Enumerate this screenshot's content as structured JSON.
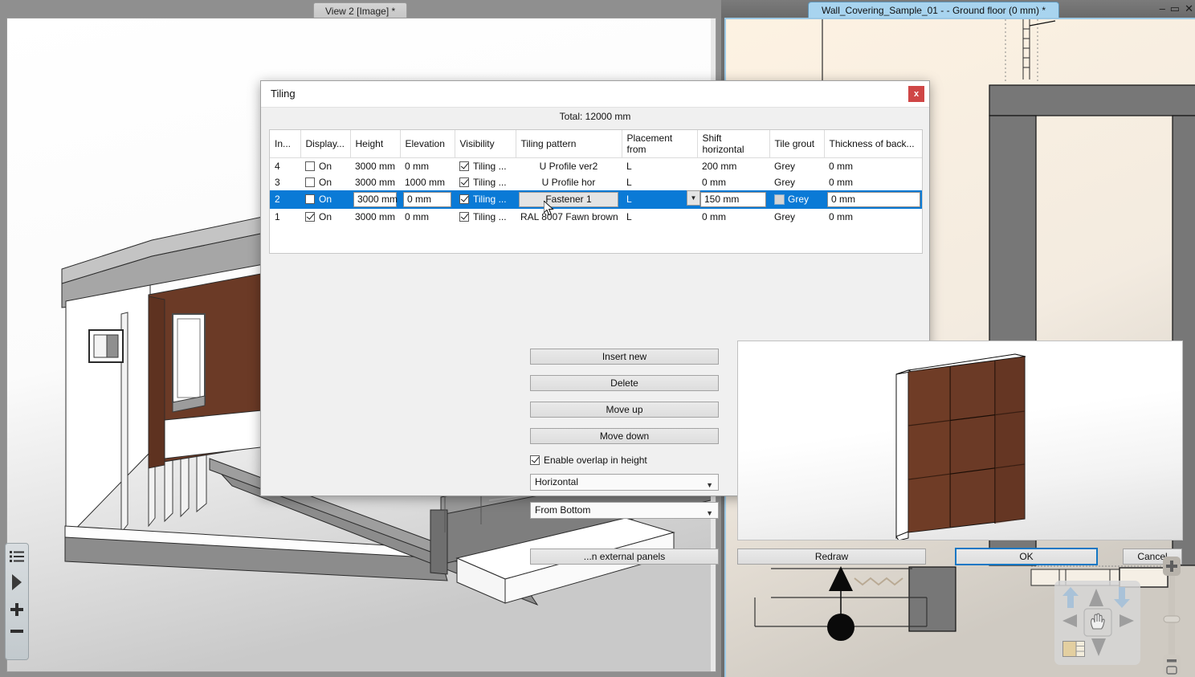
{
  "view3d_window": {
    "tab_label": "View 2 [Image] *"
  },
  "plan_window": {
    "tab_label": "Wall_Covering_Sample_01 -  - Ground floor (0 mm) *",
    "minimize_icon": "minimize-icon",
    "maximize_icon": "maximize-icon",
    "close_icon": "close-icon",
    "minimize_glyph": "–",
    "maximize_glyph": "▭",
    "close_glyph": "✕"
  },
  "dialog": {
    "title": "Tiling",
    "close_label": "x",
    "total_label": "Total: 12000 mm",
    "table": {
      "columns": [
        "In...",
        "Display...",
        "Height",
        "Elevation",
        "Visibility",
        "Tiling pattern",
        "Placement from",
        "Shift horizontal",
        "Tile grout",
        "Thickness of back..."
      ],
      "rows": [
        {
          "index": "4",
          "display_checked": false,
          "display_label": "On",
          "height": "3000 mm",
          "elevation": "0 mm",
          "visibility_checked": true,
          "visibility_label": "Tiling ...",
          "tiling_pattern": "U Profile ver2",
          "placement_from": "L",
          "shift_horizontal": "200 mm",
          "tile_grout": "Grey",
          "thickness_back": "0 mm",
          "selected": false
        },
        {
          "index": "3",
          "display_checked": false,
          "display_label": "On",
          "height": "3000 mm",
          "elevation": "1000 mm",
          "visibility_checked": true,
          "visibility_label": "Tiling ...",
          "tiling_pattern": "U Profile hor",
          "placement_from": "L",
          "shift_horizontal": "0 mm",
          "tile_grout": "Grey",
          "thickness_back": "0 mm",
          "selected": false
        },
        {
          "index": "2",
          "display_checked": false,
          "display_label": "On",
          "height": "3000 mm",
          "elevation": "0 mm",
          "visibility_checked": true,
          "visibility_label": "Tiling ...",
          "tiling_pattern": "Fastener 1",
          "placement_from": "L",
          "shift_horizontal": "150 mm",
          "tile_grout": "Grey",
          "thickness_back": "0 mm",
          "selected": true
        },
        {
          "index": "1",
          "display_checked": true,
          "display_label": "On",
          "height": "3000 mm",
          "elevation": "0 mm",
          "visibility_checked": true,
          "visibility_label": "Tiling ...",
          "tiling_pattern": "RAL 8007 Fawn brown",
          "placement_from": "L",
          "shift_horizontal": "0 mm",
          "tile_grout": "Grey",
          "thickness_back": "0 mm",
          "selected": false
        }
      ]
    },
    "buttons": {
      "insert_new": "Insert new",
      "delete": "Delete",
      "move_up": "Move up",
      "move_down": "Move down",
      "external_panels": "...n external panels",
      "redraw": "Redraw",
      "ok": "OK",
      "cancel": "Cancel"
    },
    "overlap_checkbox": {
      "label": "Enable overlap in height",
      "checked": true
    },
    "orientation_select": {
      "value": "Horizontal",
      "caret": "⌄"
    },
    "origin_select": {
      "value": "From Bottom",
      "caret": "⌄"
    }
  },
  "mini_toolbar": {
    "items": [
      {
        "icon": "list-icon"
      },
      {
        "icon": "play-triangle-icon"
      },
      {
        "icon": "plus-icon"
      },
      {
        "icon": "minus-icon"
      }
    ]
  },
  "nav_pad": {
    "items": [
      {
        "icon": "arrow-up-thick-icon"
      },
      {
        "icon": "arrow-up-small-icon"
      },
      {
        "icon": "arrow-down-thick-icon"
      },
      {
        "icon": "arrow-left-small-icon"
      },
      {
        "icon": "pan-hand-icon"
      },
      {
        "icon": "arrow-right-small-icon"
      },
      {
        "icon": "layer-swatch-icon"
      },
      {
        "icon": "arrow-down-small-icon"
      }
    ]
  },
  "zoom_slider": {
    "plus_icon": "zoom-in-icon",
    "minus_icon": "zoom-out-icon",
    "handle_icon": "slider-handle-icon"
  },
  "colors": {
    "selection_blue": "#0a7ad6",
    "close_red": "#cf4646",
    "panel_brown": "#6b3a26",
    "plan_cream": "#fdf2e2",
    "plan_wall_grey": "#777777",
    "tab_blue": "#a8d4ef",
    "ok_border": "#1477c4"
  }
}
